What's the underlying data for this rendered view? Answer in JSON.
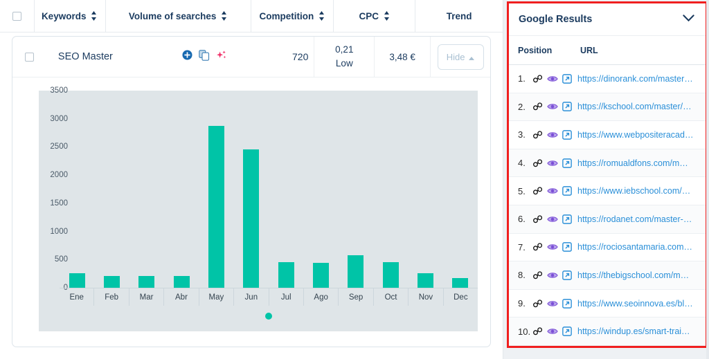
{
  "table": {
    "columns": [
      {
        "label": "",
        "icon": "checkbox",
        "sortable": false
      },
      {
        "label": "Keywords",
        "sortable": true
      },
      {
        "label": "Volume of searches",
        "sortable": true
      },
      {
        "label": "Competition",
        "sortable": true
      },
      {
        "label": "CPC",
        "sortable": true
      },
      {
        "label": "Trend",
        "sortable": false
      }
    ],
    "row": {
      "keyword": "SEO Master",
      "volume": "720",
      "competition_value": "0,21",
      "competition_level": "Low",
      "cpc": "3,48 €",
      "hide_label": "Hide",
      "icons": [
        "add-circle-icon",
        "copy-icon",
        "ai-sparkle-icon"
      ]
    }
  },
  "chart_data": {
    "type": "bar",
    "title": "",
    "xlabel": "",
    "ylabel": "",
    "categories": [
      "Ene",
      "Feb",
      "Mar",
      "Abr",
      "May",
      "Jun",
      "Jul",
      "Ago",
      "Sep",
      "Oct",
      "Nov",
      "Dec"
    ],
    "values": [
      260,
      210,
      210,
      210,
      2880,
      2460,
      460,
      440,
      580,
      450,
      260,
      170
    ],
    "ylim": [
      0,
      3500
    ],
    "yticks": [
      0,
      500,
      1000,
      1500,
      2000,
      2500,
      3000,
      3500
    ],
    "ytick_labels": [
      "0",
      "500",
      "1000",
      "1500",
      "2000",
      "2500",
      "3000",
      "3500"
    ],
    "grid": false,
    "legend": "none",
    "series_color": "#00c4a7",
    "plot_background": "#dfe5e8",
    "pagination_dots": 1,
    "active_dot": 0
  },
  "google_results": {
    "title": "Google Results",
    "collapse_icon": "chevron-down-icon",
    "columns": {
      "position": "Position",
      "url": "URL"
    },
    "rows": [
      {
        "position": "1.",
        "url": "https://dinorank.com/master…"
      },
      {
        "position": "2.",
        "url": "https://kschool.com/master/…"
      },
      {
        "position": "3.",
        "url": "https://www.webpositeracad…"
      },
      {
        "position": "4.",
        "url": "https://romualdfons.com/m…"
      },
      {
        "position": "5.",
        "url": "https://www.iebschool.com/…"
      },
      {
        "position": "6.",
        "url": "https://rodanet.com/master-…"
      },
      {
        "position": "7.",
        "url": "https://rociosantamaria.com…"
      },
      {
        "position": "8.",
        "url": "https://thebigschool.com/m…"
      },
      {
        "position": "9.",
        "url": "https://www.seoinnova.es/bl…"
      },
      {
        "position": "10.",
        "url": "https://windup.es/smart-trai…"
      }
    ],
    "row_icons": [
      "link-chain-icon",
      "eye-icon",
      "external-link-icon"
    ],
    "highlight_border_color": "#f01f1f"
  },
  "colors": {
    "accent_teal": "#00c4a7",
    "link_blue": "#2a8fd8",
    "heading_navy": "#1b3b5f",
    "eye_purple": "#7b4fd6",
    "ai_pink": "#f0336b",
    "add_blue": "#1769b0",
    "chart_bg": "#dfe5e8",
    "highlight_red": "#f01f1f"
  }
}
